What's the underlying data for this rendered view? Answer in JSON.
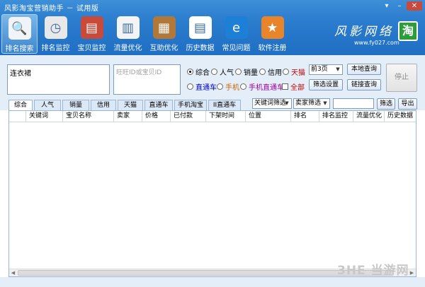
{
  "app": {
    "title": "风影淘宝营销助手 － 试用版"
  },
  "window_buttons": [
    "▾",
    "–",
    "✕"
  ],
  "toolbar": [
    {
      "label": "排名搜索",
      "icon": "magnifier-icon",
      "color": "#f0f4f8",
      "glyph": "🔍",
      "active": true
    },
    {
      "label": "排名监控",
      "icon": "clock-icon",
      "color": "#e8e8e8",
      "glyph": "◷"
    },
    {
      "label": "宝贝监控",
      "icon": "books-icon",
      "color": "#c84b3a",
      "glyph": "▤"
    },
    {
      "label": "流量优化",
      "icon": "bar-chart-icon",
      "color": "#f4f4f4",
      "glyph": "▥"
    },
    {
      "label": "互助优化",
      "icon": "clipboard-icon",
      "color": "#b0793a",
      "glyph": "▦"
    },
    {
      "label": "历史数据",
      "icon": "document-icon",
      "color": "#ffffff",
      "glyph": "▤"
    },
    {
      "label": "常见问题",
      "icon": "ie-icon",
      "color": "#1e7fd6",
      "glyph": "e"
    },
    {
      "label": "软件注册",
      "icon": "star-icon",
      "color": "#e8842a",
      "glyph": "★"
    }
  ],
  "logo": {
    "main": "风影网络",
    "url": "www.fy027.com",
    "tao": "淘"
  },
  "controls": {
    "keyword_value": "连衣裙",
    "shop_placeholder": "旺旺ID或宝贝ID",
    "sort_options": [
      {
        "label": "综合",
        "checked": true,
        "color": "#000000"
      },
      {
        "label": "人气",
        "checked": false,
        "color": "#000000"
      },
      {
        "label": "销量",
        "checked": false,
        "color": "#000000"
      },
      {
        "label": "信用",
        "checked": false,
        "color": "#000000"
      },
      {
        "label": "天猫",
        "checked": false,
        "color": "#cc0000"
      }
    ],
    "platform_options": [
      {
        "label": "直通车",
        "color": "#0000cc"
      },
      {
        "label": "手机",
        "color": "#cc6600"
      },
      {
        "label": "手机直通车",
        "color": "#990099"
      }
    ],
    "all_label": "全部",
    "all_color": "#cc0000",
    "pages_value": "前3页",
    "local_query": "本地查询",
    "filter_settings": "筛选设置",
    "link_query": "链接查询",
    "stop": "停止"
  },
  "tabs": [
    "综合",
    "人气",
    "销量",
    "信用",
    "天猫",
    "直通车",
    "手机淘宝",
    "II直通车"
  ],
  "filters": {
    "keyword_filter": "关键词筛选",
    "seller_filter": "卖家筛选",
    "filter_button": "筛选",
    "export_button": "导出"
  },
  "table": {
    "columns": [
      "",
      "关键词",
      "宝贝名称",
      "卖家",
      "价格",
      "已付款",
      "下架时间",
      "位置",
      "排名",
      "排名监控",
      "流量优化",
      "历史数据"
    ]
  },
  "watermark": "3HE 当游网"
}
